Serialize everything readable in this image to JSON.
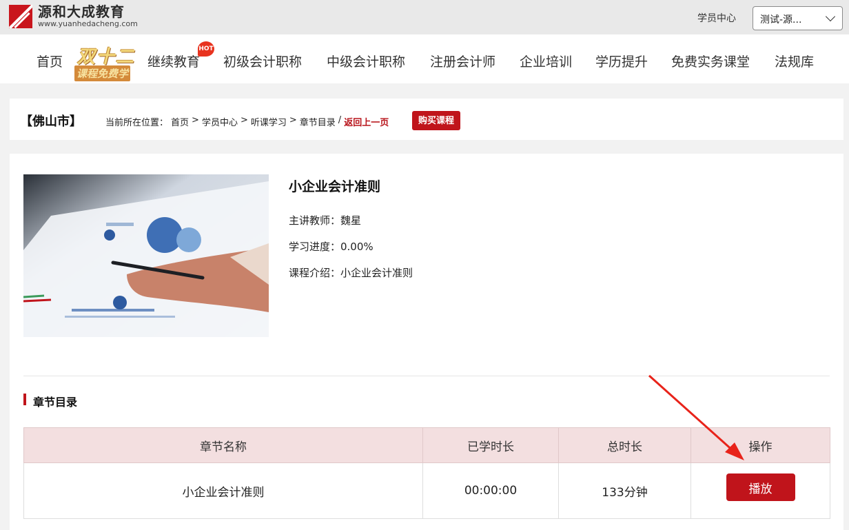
{
  "header": {
    "logo_cn": "源和大成教育",
    "logo_en": "www.yuanhedacheng.com",
    "user_center": "学员中心",
    "account": "测试-源..."
  },
  "nav": {
    "items": [
      "首页",
      "继续教育",
      "初级会计职称",
      "中级会计职称",
      "注册会计师",
      "企业培训",
      "学历提升",
      "免费实务课堂",
      "法规库"
    ],
    "promo_top": "双十二",
    "promo_bottom": "课程免费学",
    "hot_badge": "HOT"
  },
  "location": {
    "city": "【佛山市】",
    "prefix": "当前所在位置：",
    "crumbs": [
      "首页",
      "学员中心",
      "听课学习",
      "章节目录"
    ],
    "sep": ">",
    "slash": "/",
    "back": "返回上一页",
    "buy": "购买课程"
  },
  "course": {
    "title": "小企业会计准则",
    "teacher": "主讲教师：魏星",
    "progress": "学习进度：0.00%",
    "intro": "课程介绍：小企业会计准则"
  },
  "chapters": {
    "section_title": "章节目录",
    "headers": [
      "章节名称",
      "已学时长",
      "总时长",
      "操作"
    ],
    "rows": [
      {
        "name": "小企业会计准则",
        "learned": "00:00:00",
        "total": "133分钟",
        "action": "播放"
      }
    ]
  },
  "colors": {
    "accent": "#c0141b",
    "header_bg": "#f3dfe0"
  }
}
